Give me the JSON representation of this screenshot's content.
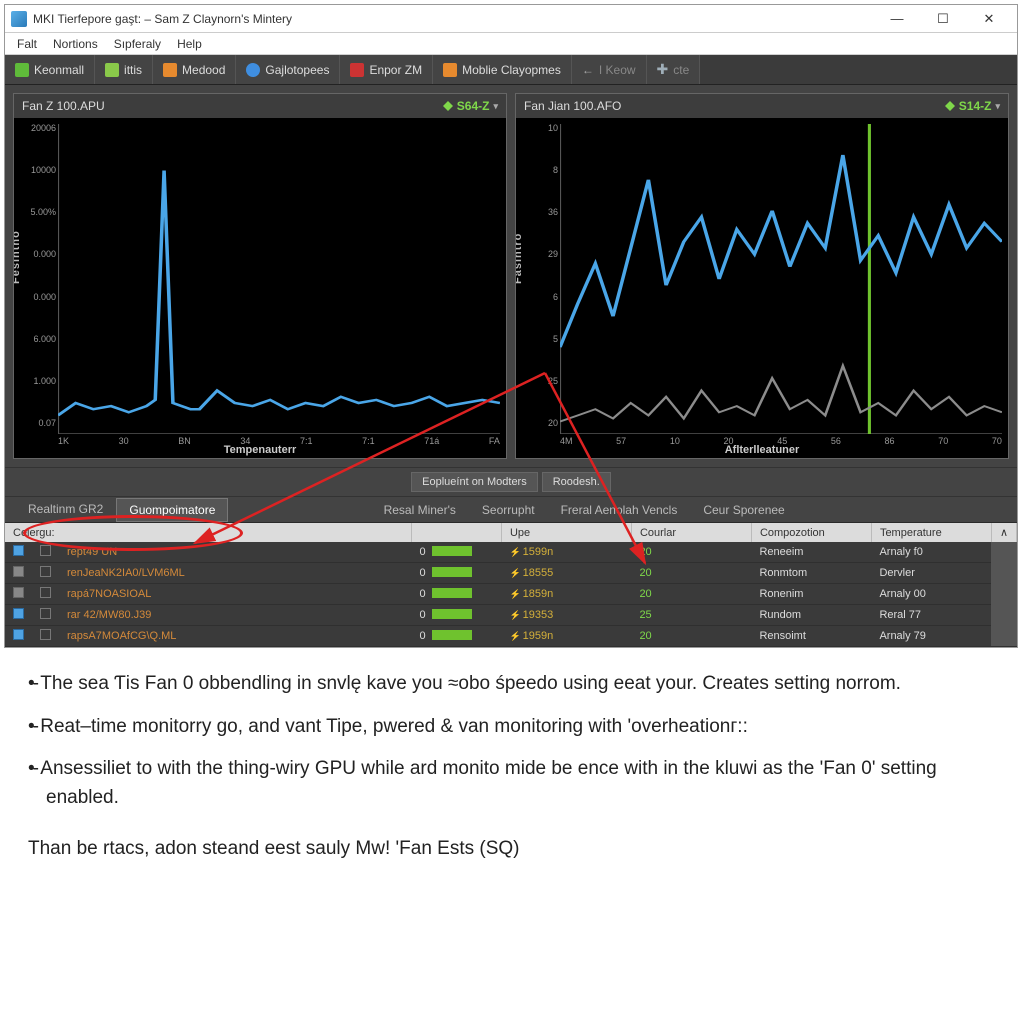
{
  "window": {
    "title": "MKI Tierfepore gaşt: – Sam Z Claynorn's Mintery"
  },
  "menubar": [
    "Falt",
    "Nortions",
    "Sıpferaly",
    "Help"
  ],
  "toolbar": [
    {
      "icon": "green",
      "label": "Keonmall"
    },
    {
      "icon": "lime",
      "label": "ittis"
    },
    {
      "icon": "orange",
      "label": "Medood"
    },
    {
      "icon": "blue",
      "label": "Gajlotopees"
    },
    {
      "icon": "red",
      "label": "Enpor ZM"
    },
    {
      "icon": "orange",
      "label": "Moblie Clayopmes"
    },
    {
      "icon": "arrow",
      "label": "I Keow",
      "dim": true
    },
    {
      "icon": "plus",
      "label": "cte",
      "dim": true
    }
  ],
  "charts": [
    {
      "title": "Fan Z 100.APU",
      "badge": "S64-Z",
      "ylabel": "Fesintno",
      "xlabel": "Tempenauterr",
      "yticks": [
        "20006",
        "10000",
        "5.00%",
        "0.000",
        "0.000",
        "6.000",
        "1.000",
        "0.07"
      ],
      "xticks": [
        "1K",
        "30",
        "BN",
        "34",
        "7:1",
        "7:1",
        "71á",
        "FA"
      ]
    },
    {
      "title": "Fan Jian 100.AFO",
      "badge": "S14-Z",
      "ylabel": "Fasintro",
      "xlabel": "Aflterlleatuner",
      "yticks": [
        "10",
        "8",
        "36",
        "29",
        "6",
        "5",
        "25",
        "20"
      ],
      "xticks": [
        "4M",
        "57",
        "10",
        "20",
        "45",
        "56",
        "86",
        "70",
        "70"
      ]
    }
  ],
  "midbar": [
    "Eoplueínt on Modters",
    "Roodesh."
  ],
  "tabs_left": [
    {
      "label": "Realtinm GR2",
      "active": false,
      "icon": true
    },
    {
      "label": "Guompoimatore",
      "active": true
    }
  ],
  "tabs_right": [
    "Resal Miner's",
    "Seorrupht",
    "Freral Aenolah Vencls",
    "Ceur Sporenee"
  ],
  "columns": [
    "Celergu:",
    "",
    "",
    "Upe",
    "Courlar",
    "Compozotion",
    "Temperature"
  ],
  "rows": [
    {
      "chk": true,
      "name": "rept49 UN",
      "zero": "0",
      "upe": "1599n",
      "cou": "20",
      "comp": "Reneeim",
      "temp": "Arnaly f0"
    },
    {
      "chk": false,
      "name": "renJeaNK2IA0/LVM6ML",
      "zero": "0",
      "upe": "18555",
      "cou": "20",
      "comp": "Ronmtom",
      "temp": "Dervler"
    },
    {
      "chk": false,
      "name": "rapá7NOASIOAL",
      "zero": "0",
      "upe": "1859n",
      "cou": "20",
      "comp": "Ronenim",
      "temp": "Arnaly 00"
    },
    {
      "chk": true,
      "name": "rar 42/MW80.J39",
      "zero": "0",
      "upe": "19353",
      "cou": "25",
      "comp": "Rundom",
      "temp": "Reral 77"
    },
    {
      "chk": true,
      "name": "rapsA7MOAfCG\\Q.ML",
      "zero": "0",
      "upe": "1959n",
      "cou": "20",
      "comp": "Rensoimt",
      "temp": "Arnaly 79"
    }
  ],
  "bullets": [
    "The sea Ƭis Fan 0 obbendling in snvlę kave you ≈obo śpeedo using eeat your. Creates setting norrom.",
    "Reat–time monitorry go, and vant Tipe, pwered & van monitoring with 'overheationг::",
    "Ansessiliet to with the thing-wiry GPU while ard monito mide be ence with in the kluwi as the 'Fan 0' setting enabled."
  ],
  "footer": "Than be rtacs, adon steand eest sauly Mw! 'Fan Ests (SQ)",
  "chart_data": [
    {
      "type": "line",
      "title": "Fan Z 100.APU",
      "xlabel": "Tempenauterr",
      "ylabel": "Fesintno",
      "x": [
        0,
        4,
        8,
        12,
        16,
        20,
        22,
        24,
        26,
        28,
        30,
        32,
        36,
        40,
        44,
        48,
        52,
        56,
        60,
        64,
        68,
        72,
        76,
        80,
        84,
        88,
        92,
        96,
        100
      ],
      "series": [
        {
          "name": "primary",
          "color": "#4aa6e8",
          "values": [
            6,
            10,
            8,
            9,
            7,
            9,
            11,
            85,
            10,
            9,
            8,
            8,
            14,
            10,
            9,
            11,
            8,
            10,
            9,
            12,
            10,
            11,
            9,
            10,
            12,
            9,
            10,
            11,
            10
          ]
        }
      ],
      "ylim": [
        0,
        100
      ]
    },
    {
      "type": "line",
      "title": "Fan Jian 100.AFO",
      "xlabel": "Aflterlleatuner",
      "ylabel": "Fasintro",
      "x": [
        0,
        4,
        8,
        12,
        16,
        20,
        24,
        28,
        32,
        36,
        40,
        44,
        48,
        52,
        56,
        60,
        64,
        68,
        72,
        76,
        80,
        84,
        88,
        92,
        96,
        100
      ],
      "series": [
        {
          "name": "primary",
          "color": "#4aa6e8",
          "values": [
            28,
            42,
            55,
            38,
            60,
            82,
            48,
            62,
            70,
            50,
            66,
            58,
            72,
            54,
            68,
            60,
            90,
            56,
            64,
            52,
            70,
            58,
            74,
            60,
            68,
            62
          ]
        },
        {
          "name": "secondary",
          "color": "#8c8c8c",
          "values": [
            4,
            6,
            8,
            5,
            10,
            6,
            12,
            5,
            14,
            7,
            9,
            6,
            18,
            8,
            11,
            6,
            22,
            7,
            10,
            6,
            14,
            8,
            12,
            6,
            9,
            7
          ]
        }
      ],
      "ylim": [
        0,
        100
      ],
      "annotations": [
        {
          "type": "vline",
          "x": 70,
          "color": "#6fc22e"
        }
      ]
    }
  ]
}
